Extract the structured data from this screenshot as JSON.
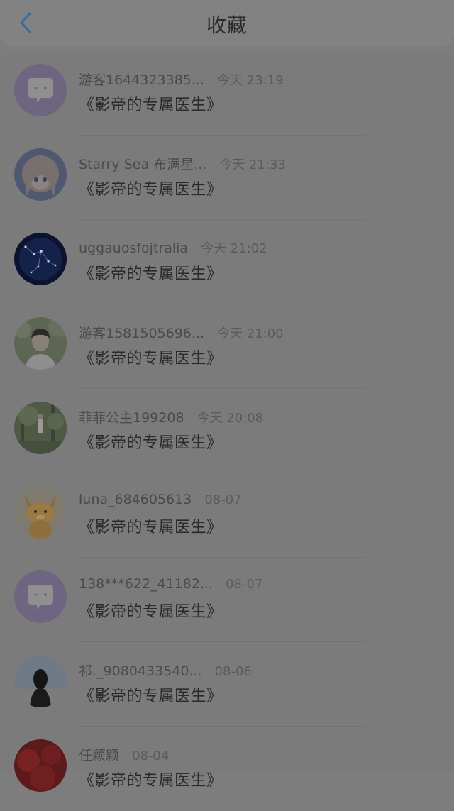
{
  "header": {
    "title": "收藏",
    "back_icon": "chevron-left-icon",
    "accent": "#2f6f9f"
  },
  "items": [
    {
      "username": "游客1644323385...",
      "time": "今天 23:19",
      "book": "《影帝的专属医生》",
      "avatar": "default-chat-avatar-icon"
    },
    {
      "username": "Starry Sea 布满星...",
      "time": "今天 21:33",
      "book": "《影帝的专属医生》",
      "avatar": "anime-girl-avatar"
    },
    {
      "username": "uggauosfojtralia",
      "time": "今天 21:02",
      "book": "《影帝的专属医生》",
      "avatar": "constellation-avatar"
    },
    {
      "username": "游客1581505696...",
      "time": "今天 21:00",
      "book": "《影帝的专属医生》",
      "avatar": "boy-photo-avatar"
    },
    {
      "username": "菲菲公主199208",
      "time": "今天 20:08",
      "book": "《影帝的专属医生》",
      "avatar": "forest-photo-avatar"
    },
    {
      "username": "luna_684605613",
      "time": "08-07",
      "book": "《影帝的专属医生》",
      "avatar": "fox-cartoon-avatar"
    },
    {
      "username": "138***622_41182...",
      "time": "08-07",
      "book": "《影帝的专属医生》",
      "avatar": "default-chat-avatar-icon"
    },
    {
      "username": "祁._9080433540...",
      "time": "08-06",
      "book": "《影帝的专属医生》",
      "avatar": "girl-back-photo-avatar"
    },
    {
      "username": "任颖颖",
      "time": "08-04",
      "book": "《影帝的专属医生》",
      "avatar": "red-photo-avatar"
    }
  ]
}
